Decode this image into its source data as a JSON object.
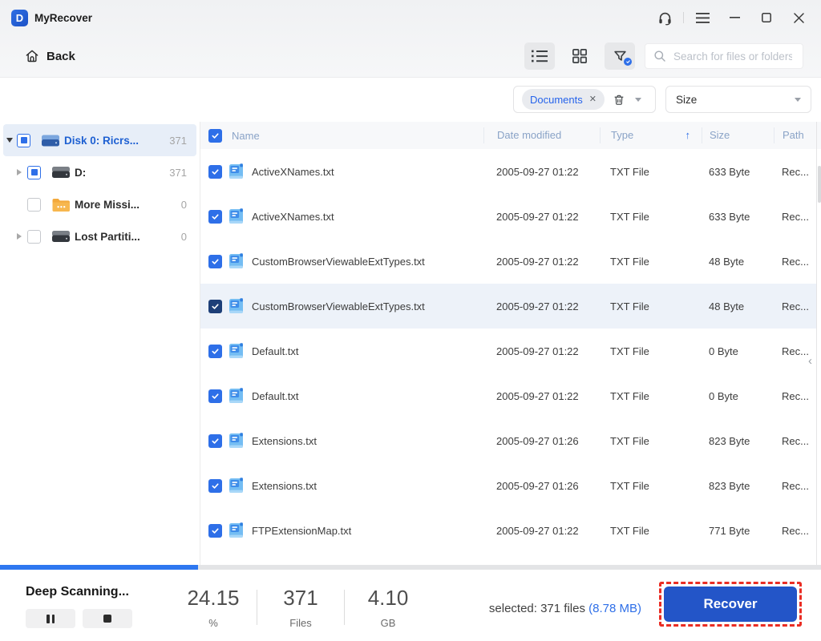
{
  "titlebar": {
    "title": "MyRecover",
    "logo_letter": "D"
  },
  "toolbar": {
    "back_label": "Back",
    "search_placeholder": "Search for files or folders"
  },
  "filterbar": {
    "chip_label": "Documents",
    "size_label": "Size"
  },
  "icons": {
    "chip_remove": "✕",
    "sort_ascending": "↑",
    "panel_collapse": "‹"
  },
  "sidebar": {
    "items": [
      {
        "label": "Disk 0:  Ricrs...",
        "count": "371",
        "icon": "disk-blue",
        "checkbox": "indeterminate",
        "arrow": "expanded",
        "selected": true,
        "level": 0
      },
      {
        "label": "D:",
        "count": "371",
        "icon": "disk-dark",
        "checkbox": "indeterminate",
        "arrow": "collapsed",
        "selected": false,
        "level": 1
      },
      {
        "label": "More Missi...",
        "count": "0",
        "icon": "folder",
        "checkbox": "empty",
        "arrow": "none",
        "selected": false,
        "level": 1
      },
      {
        "label": "Lost Partiti...",
        "count": "0",
        "icon": "disk-dark",
        "checkbox": "empty",
        "arrow": "collapsed",
        "selected": false,
        "level": 1
      }
    ]
  },
  "table": {
    "columns": [
      "Name",
      "Date modified",
      "Type",
      "Size",
      "Path"
    ],
    "sort_column": "Type",
    "sort_direction": "ascending",
    "rows": [
      {
        "name": "ActiveXNames.txt",
        "date": "2005-09-27 01:22",
        "type": "TXT File",
        "size": "633 Byte",
        "path": "Rec...",
        "checked": true,
        "highlighted": false
      },
      {
        "name": "ActiveXNames.txt",
        "date": "2005-09-27 01:22",
        "type": "TXT File",
        "size": "633 Byte",
        "path": "Rec...",
        "checked": true,
        "highlighted": false
      },
      {
        "name": "CustomBrowserViewableExtTypes.txt",
        "date": "2005-09-27 01:22",
        "type": "TXT File",
        "size": "48 Byte",
        "path": "Rec...",
        "checked": true,
        "highlighted": false
      },
      {
        "name": "CustomBrowserViewableExtTypes.txt",
        "date": "2005-09-27 01:22",
        "type": "TXT File",
        "size": "48 Byte",
        "path": "Rec...",
        "checked": true,
        "highlighted": true
      },
      {
        "name": "Default.txt",
        "date": "2005-09-27 01:22",
        "type": "TXT File",
        "size": "0 Byte",
        "path": "Rec...",
        "checked": true,
        "highlighted": false
      },
      {
        "name": "Default.txt",
        "date": "2005-09-27 01:22",
        "type": "TXT File",
        "size": "0 Byte",
        "path": "Rec...",
        "checked": true,
        "highlighted": false
      },
      {
        "name": "Extensions.txt",
        "date": "2005-09-27 01:26",
        "type": "TXT File",
        "size": "823 Byte",
        "path": "Rec...",
        "checked": true,
        "highlighted": false
      },
      {
        "name": "Extensions.txt",
        "date": "2005-09-27 01:26",
        "type": "TXT File",
        "size": "823 Byte",
        "path": "Rec...",
        "checked": true,
        "highlighted": false
      },
      {
        "name": "FTPExtensionMap.txt",
        "date": "2005-09-27 01:22",
        "type": "TXT File",
        "size": "771 Byte",
        "path": "Rec...",
        "checked": true,
        "highlighted": false
      }
    ]
  },
  "footer": {
    "status": "Deep Scanning...",
    "progress_percent": 24.15,
    "stats": [
      {
        "value": "24.15",
        "unit": "%"
      },
      {
        "value": "371",
        "unit": "Files"
      },
      {
        "value": "4.10",
        "unit": "GB"
      }
    ],
    "selected_text": "selected: 371 files",
    "selected_size": "(8.78 MB)",
    "recover_label": "Recover"
  },
  "colors": {
    "accent": "#2e6fe8",
    "progress_fill": "#2e77f0",
    "recover_button": "#2355c8",
    "recover_outline": "#ea2d24",
    "selected_row_bg": "#edf2f9",
    "sidebar_selected_bg": "#e7eef8",
    "header_label": "#8aa3c7"
  }
}
